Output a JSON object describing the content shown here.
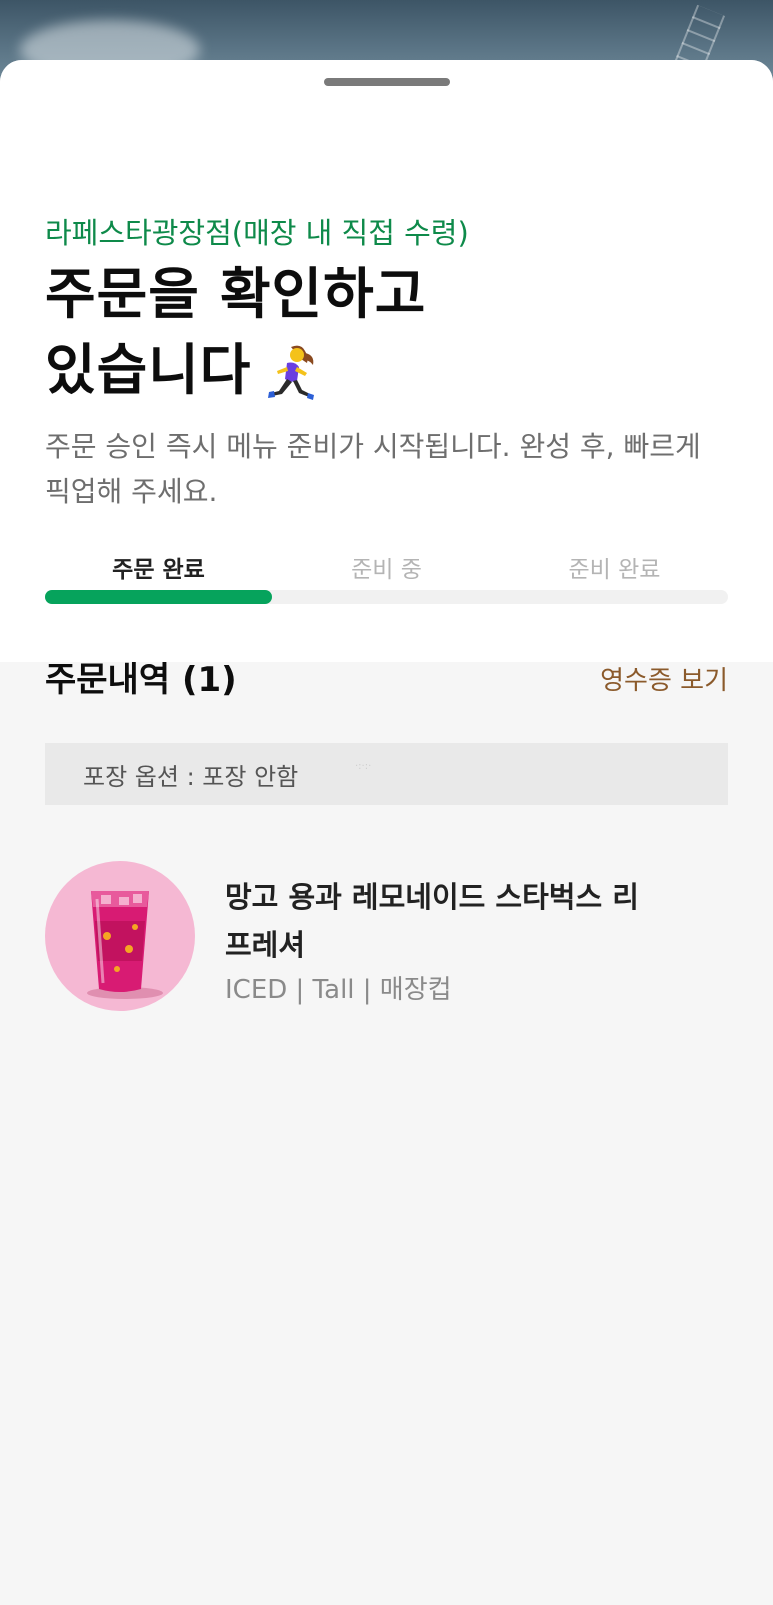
{
  "store": {
    "name": "라페스타광장점(매장 내 직접 수령)"
  },
  "headline": {
    "line1": "주문을 확인하고",
    "line2": "있습니다"
  },
  "subtitle": "주문 승인 즉시 메뉴 준비가 시작됩니다. 완성 후, 빠르게 픽업해 주세요.",
  "progress": {
    "steps": [
      {
        "label": "주문 완료",
        "active": true
      },
      {
        "label": "준비 중",
        "active": false
      },
      {
        "label": "준비 완료",
        "active": false
      }
    ],
    "fraction_complete": 0.333
  },
  "order_history": {
    "title": "주문내역 (1)",
    "receipt_link": "영수증 보기",
    "packaging_option": "포장 옵션 : 포장 안함",
    "items": [
      {
        "name": "망고 용과 레모네이드 스타벅스 리프레셔",
        "options": "ICED | Tall | 매장컵",
        "thumbnail_bg": "#f5b8d3"
      }
    ]
  },
  "colors": {
    "accent_green": "#06a35c",
    "store_green": "#0e8a4a",
    "receipt_brown": "#8b5a2b"
  },
  "icons": {
    "status_icon": "woman-running-emoji"
  }
}
